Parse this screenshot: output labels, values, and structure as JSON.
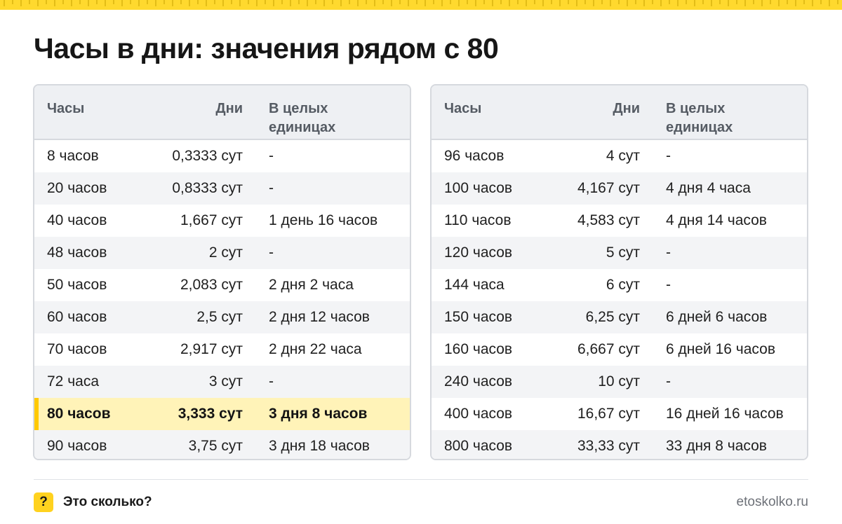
{
  "title": "Часы в дни: значения рядом с 80",
  "columns": {
    "hours": "Часы",
    "days": "Дни",
    "whole": "В целых единицах"
  },
  "left_table": [
    {
      "hours": "8 часов",
      "days": "0,3333 сут",
      "whole": "-"
    },
    {
      "hours": "20 часов",
      "days": "0,8333 сут",
      "whole": "-"
    },
    {
      "hours": "40 часов",
      "days": "1,667 сут",
      "whole": "1 день 16 часов"
    },
    {
      "hours": "48 часов",
      "days": "2 сут",
      "whole": "-"
    },
    {
      "hours": "50 часов",
      "days": "2,083 сут",
      "whole": "2 дня 2 часа"
    },
    {
      "hours": "60 часов",
      "days": "2,5 сут",
      "whole": "2 дня 12 часов"
    },
    {
      "hours": "70 часов",
      "days": "2,917 сут",
      "whole": "2 дня 22 часа"
    },
    {
      "hours": "72 часа",
      "days": "3 сут",
      "whole": "-"
    },
    {
      "hours": "80 часов",
      "days": "3,333 сут",
      "whole": "3 дня 8 часов",
      "highlighted": true
    },
    {
      "hours": "90 часов",
      "days": "3,75 сут",
      "whole": "3 дня 18 часов"
    }
  ],
  "right_table": [
    {
      "hours": "96 часов",
      "days": "4 сут",
      "whole": "-"
    },
    {
      "hours": "100 часов",
      "days": "4,167 сут",
      "whole": "4 дня 4 часа"
    },
    {
      "hours": "110 часов",
      "days": "4,583 сут",
      "whole": "4 дня 14 часов"
    },
    {
      "hours": "120 часов",
      "days": "5 сут",
      "whole": "-"
    },
    {
      "hours": "144 часа",
      "days": "6 сут",
      "whole": "-"
    },
    {
      "hours": "150 часов",
      "days": "6,25 сут",
      "whole": "6 дней 6 часов"
    },
    {
      "hours": "160 часов",
      "days": "6,667 сут",
      "whole": "6 дней 16 часов"
    },
    {
      "hours": "240 часов",
      "days": "10 сут",
      "whole": "-"
    },
    {
      "hours": "400 часов",
      "days": "16,67 сут",
      "whole": "16 дней 16 часов"
    },
    {
      "hours": "800 часов",
      "days": "33,33 сут",
      "whole": "33 дня 8 часов"
    }
  ],
  "footer": {
    "badge": "?",
    "brand": "Это сколько?",
    "url": "etoskolko.ru"
  },
  "colors": {
    "accent": "#ffd21f",
    "highlight_row": "#fff3b8",
    "header_bg": "#eef0f3",
    "border": "#d6d9de"
  }
}
